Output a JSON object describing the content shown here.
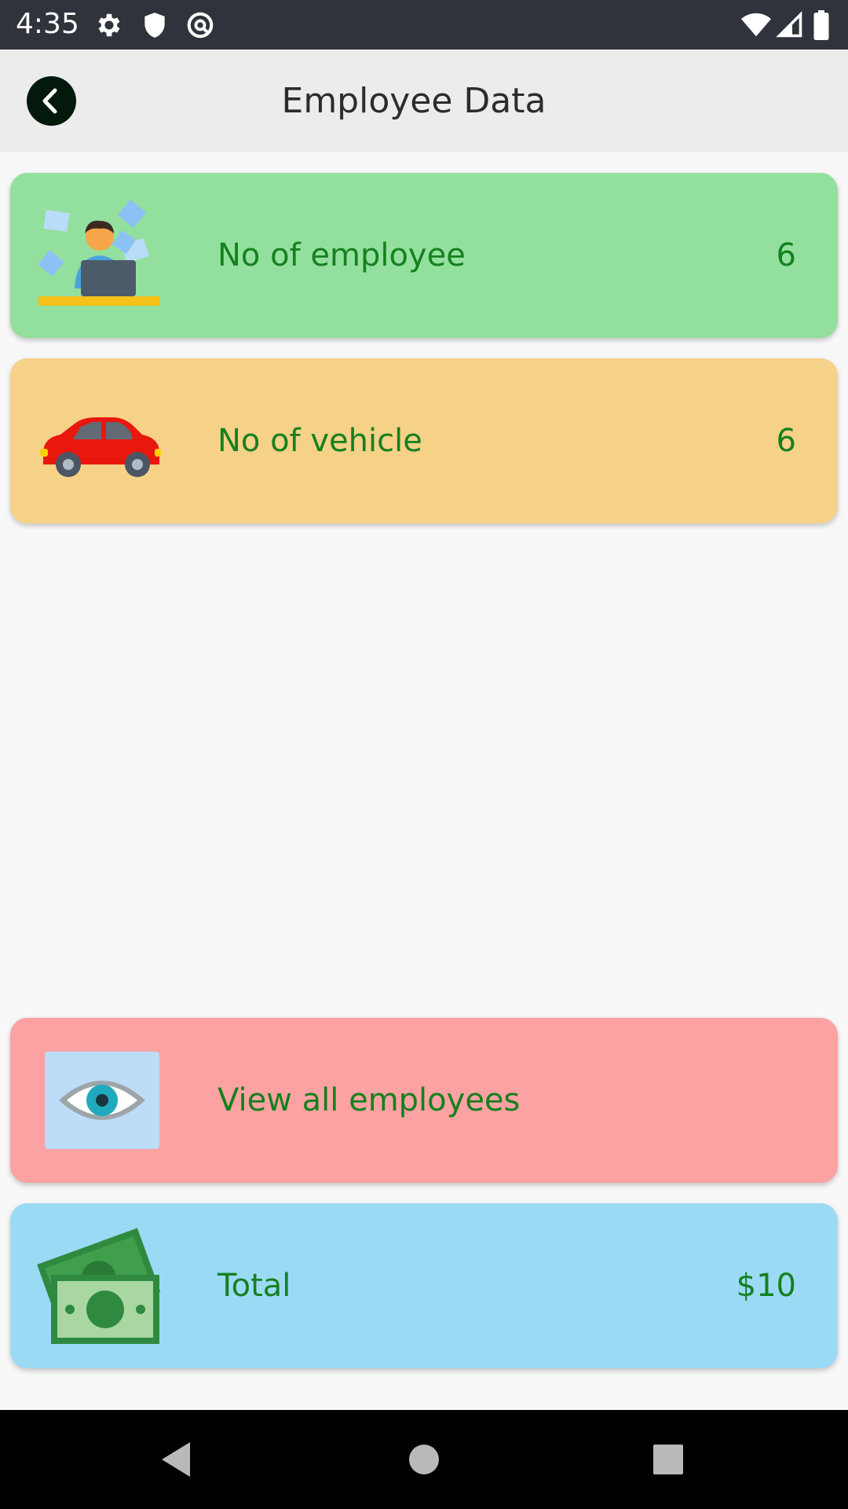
{
  "status_bar": {
    "time": "4:35",
    "icons": [
      "gear-icon",
      "shield-icon",
      "vpn-key-icon",
      "wifi-icon",
      "cell-signal-icon",
      "battery-icon"
    ]
  },
  "app_bar": {
    "title": "Employee Data",
    "back_icon": "chevron-left-icon"
  },
  "cards": [
    {
      "icon": "employee-at-laptop-icon",
      "label": "No of employee",
      "value": "6",
      "color": "#93e09e"
    },
    {
      "icon": "red-car-icon",
      "label": "No of vehicle",
      "value": "6",
      "color": "#f6d188"
    },
    {
      "icon": "eye-icon",
      "label": "View all employees",
      "value": "",
      "color": "#fca2a3"
    },
    {
      "icon": "money-bills-icon",
      "label": "Total",
      "value": "$10",
      "color": "#9bdaf4"
    }
  ],
  "text_color": "#15801f",
  "nav_bar": {
    "icons": [
      "back-triangle-icon",
      "home-circle-icon",
      "recents-square-icon"
    ]
  }
}
